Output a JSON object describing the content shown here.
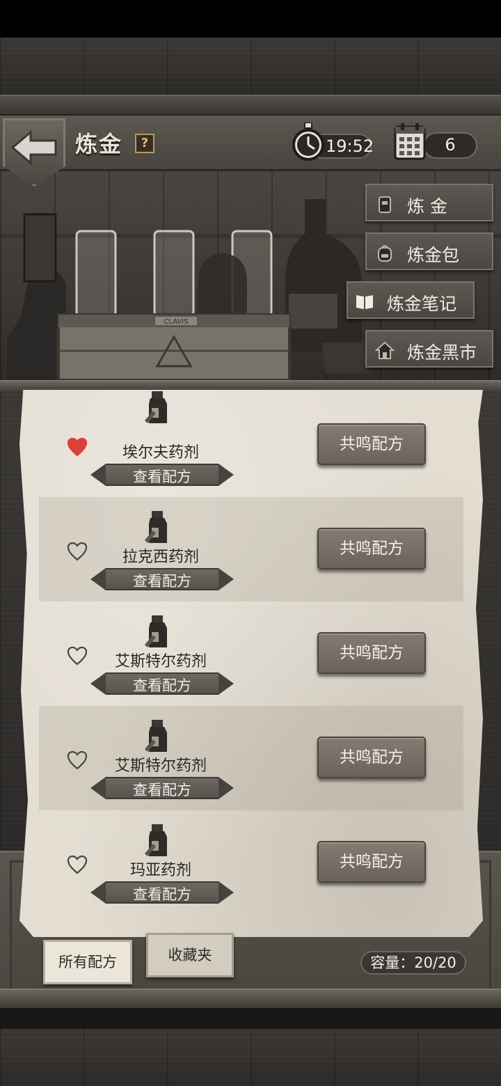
{
  "header": {
    "title": "炼金",
    "help": "?",
    "time": "19:52",
    "day": "6"
  },
  "side_menu": [
    {
      "label": "炼 金",
      "icon": "furnace-icon"
    },
    {
      "label": "炼金包",
      "icon": "backpack-icon"
    },
    {
      "label": "炼金笔记",
      "icon": "book-icon"
    },
    {
      "label": "炼金黑市",
      "icon": "house-icon"
    }
  ],
  "scene": {
    "crate_label": "CLAVIS"
  },
  "recipes": [
    {
      "name": "埃尔夫药剂",
      "favorited": true,
      "view_label": "查看配方",
      "resonate_label": "共鸣配方"
    },
    {
      "name": "拉克西药剂",
      "favorited": false,
      "view_label": "查看配方",
      "resonate_label": "共鸣配方"
    },
    {
      "name": "艾斯特尔药剂",
      "favorited": false,
      "view_label": "查看配方",
      "resonate_label": "共鸣配方"
    },
    {
      "name": "艾斯特尔药剂",
      "favorited": false,
      "view_label": "查看配方",
      "resonate_label": "共鸣配方"
    },
    {
      "name": "玛亚药剂",
      "favorited": false,
      "view_label": "查看配方",
      "resonate_label": "共鸣配方"
    }
  ],
  "tabs": {
    "all": "所有配方",
    "favorites": "收藏夹"
  },
  "capacity": "容量：20/20",
  "colors": {
    "heart_active": "#d9413a",
    "paper": "#e3ddd2",
    "wood": "#3b3835"
  }
}
